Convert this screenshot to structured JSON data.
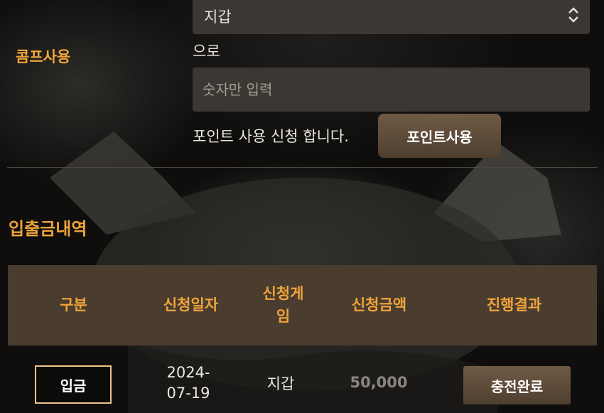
{
  "wallet_select": {
    "value": "지갑"
  },
  "comp": {
    "label": "콤프사용",
    "to_text": "으로",
    "amount_placeholder": "숫자만 입력",
    "apply_text": "포인트 사용 신청 합니다.",
    "button_label": "포인트사용"
  },
  "history": {
    "title": "입출금내역",
    "columns": [
      "구분",
      "신청일자",
      "신청게임",
      "신청금액",
      "진행결과"
    ],
    "rows": [
      {
        "type": "입금",
        "date_line1": "2024-",
        "date_line2": "07-19",
        "game": "지갑",
        "amount": "50,000",
        "status": "충전완료"
      }
    ]
  },
  "colors": {
    "accent": "#f0a43a",
    "panel": "#3c3732",
    "header_bg": "#4a3d2f",
    "button": "#5e4c3a"
  }
}
